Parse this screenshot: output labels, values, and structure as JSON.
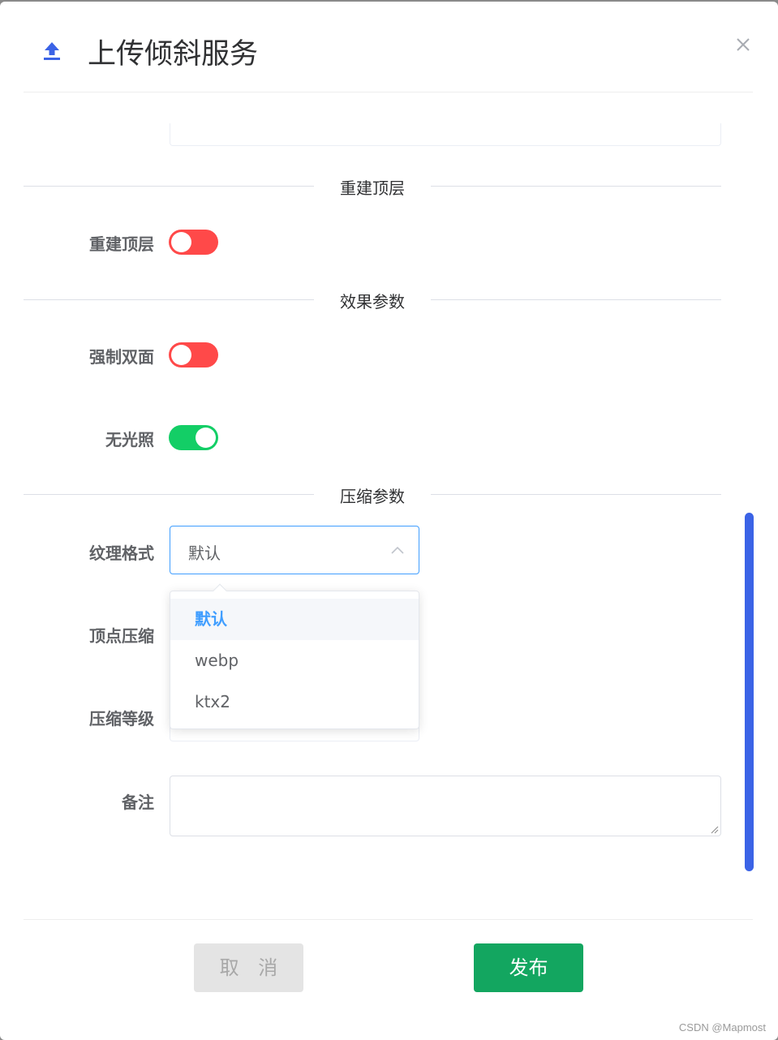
{
  "dialog": {
    "title": "上传倾斜服务",
    "icon": "upload-icon",
    "close_icon": "close-icon"
  },
  "sections": {
    "rebuild": "重建顶层",
    "effect": "效果参数",
    "compress": "压缩参数"
  },
  "fields": {
    "rebuild_top": {
      "label": "重建顶层",
      "on": false
    },
    "force_double_side": {
      "label": "强制双面",
      "on": false
    },
    "no_lighting": {
      "label": "无光照",
      "on": true
    },
    "texture_format": {
      "label": "纹理格式",
      "value": "默认"
    },
    "vertex_compress": {
      "label": "顶点压缩"
    },
    "compress_level": {
      "label": "压缩等级"
    },
    "remark": {
      "label": "备注",
      "value": ""
    }
  },
  "dropdown": {
    "options": [
      "默认",
      "webp",
      "ktx2"
    ],
    "selected": "默认"
  },
  "buttons": {
    "cancel": "取 消",
    "publish": "发布"
  },
  "colors": {
    "switch_off": "#ff4949",
    "switch_on": "#13ce66",
    "accent": "#409eff",
    "publish_button": "#13a660",
    "scrollbar": "#3b63e6"
  },
  "watermark": "CSDN @Mapmost"
}
